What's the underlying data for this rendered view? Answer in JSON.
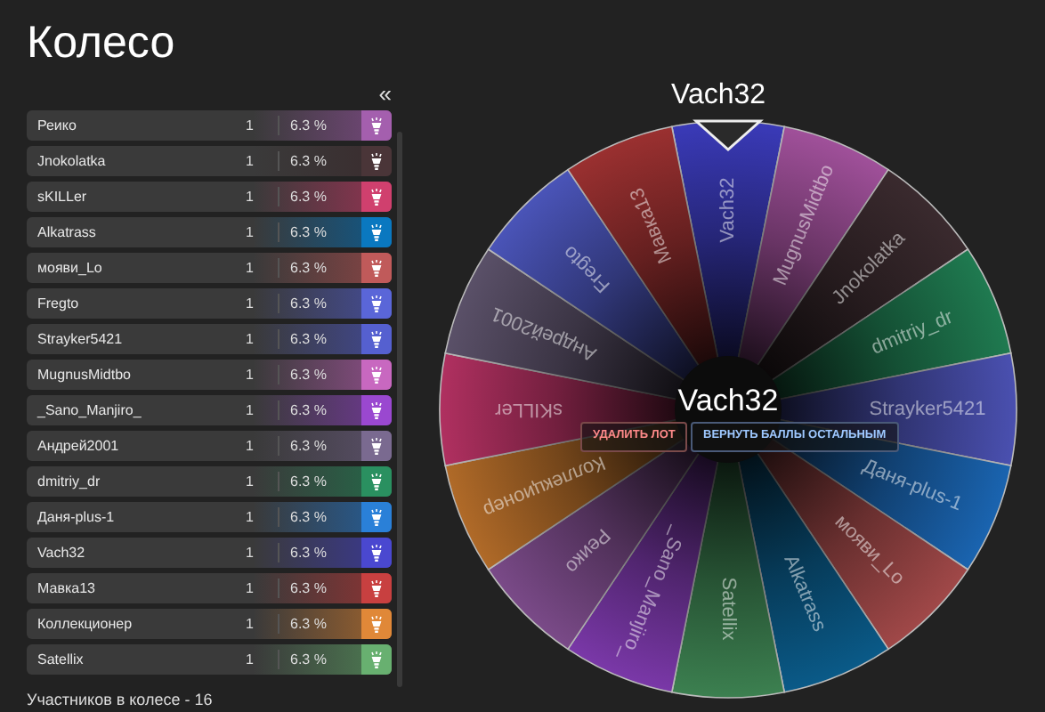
{
  "title": "Колесо",
  "collapse_toggle": "«",
  "participants": [
    {
      "name": "Реико",
      "count": "1",
      "share": "6.3 %",
      "color": "#a45fae"
    },
    {
      "name": "Jnokolatka",
      "count": "1",
      "share": "6.3 %",
      "color": "#4a3538"
    },
    {
      "name": "sKILLer",
      "count": "1",
      "share": "6.3 %",
      "color": "#d0406e"
    },
    {
      "name": "Alkatrass",
      "count": "1",
      "share": "6.3 %",
      "color": "#0a78c0"
    },
    {
      "name": "мояви_Lo",
      "count": "1",
      "share": "6.3 %",
      "color": "#c05a5a"
    },
    {
      "name": "Fregto",
      "count": "1",
      "share": "6.3 %",
      "color": "#5a66d8"
    },
    {
      "name": "Strayker5421",
      "count": "1",
      "share": "6.3 %",
      "color": "#5560d0"
    },
    {
      "name": "MugnusMidtbo",
      "count": "1",
      "share": "6.3 %",
      "color": "#c868c0"
    },
    {
      "name": "_Sano_Manjiro_",
      "count": "1",
      "share": "6.3 %",
      "color": "#9a48d0"
    },
    {
      "name": "Андрей2001",
      "count": "1",
      "share": "6.3 %",
      "color": "#7a6a90"
    },
    {
      "name": "dmitriy_dr",
      "count": "1",
      "share": "6.3 %",
      "color": "#2a9060"
    },
    {
      "name": "Даня-plus-1",
      "count": "1",
      "share": "6.3 %",
      "color": "#2a80d8"
    },
    {
      "name": "Vach32",
      "count": "1",
      "share": "6.3 %",
      "color": "#4a48d0"
    },
    {
      "name": "Мавка13",
      "count": "1",
      "share": "6.3 %",
      "color": "#c84040"
    },
    {
      "name": "Коллекционер",
      "count": "1",
      "share": "6.3 %",
      "color": "#e08838"
    },
    {
      "name": "Satellix",
      "count": "1",
      "share": "6.3 %",
      "color": "#68b070"
    }
  ],
  "footer": "Участников в колесе - 16",
  "winner_heading": "Vach32",
  "wheel": {
    "center_label": "Vach32",
    "segments": [
      {
        "label": "Vach32",
        "color": "#3a3ab8"
      },
      {
        "label": "MugnusMidtbo",
        "color": "#a0509a"
      },
      {
        "label": "Jnokolatka",
        "color": "#3a2a2e"
      },
      {
        "label": "dmitriy_dr",
        "color": "#1f7a50"
      },
      {
        "label": "Strayker5421",
        "color": "#4a50b0"
      },
      {
        "label": "Даня-plus-1",
        "color": "#1a64b0"
      },
      {
        "label": "мояви_Lo",
        "color": "#a04848"
      },
      {
        "label": "Alkatrass",
        "color": "#0a5a88"
      },
      {
        "label": "Satellix",
        "color": "#3c8050"
      },
      {
        "label": "_Sano_Manjiro_",
        "color": "#7a38a8"
      },
      {
        "label": "Реико",
        "color": "#7a4a88"
      },
      {
        "label": "Коллекционер",
        "color": "#b06a28"
      },
      {
        "label": "sKILLer",
        "color": "#b03060"
      },
      {
        "label": "Андрей2001",
        "color": "#5a5068"
      },
      {
        "label": "Fregto",
        "color": "#4a54b8"
      },
      {
        "label": "Мавка13",
        "color": "#9a3030"
      }
    ]
  },
  "actions": [
    {
      "label": "УДАЛИТЬ ЛОТ",
      "kind": "danger"
    },
    {
      "label": "ВЕРНУТЬ БАЛЛЫ ОСТАЛЬНЫМ",
      "kind": "info"
    }
  ]
}
